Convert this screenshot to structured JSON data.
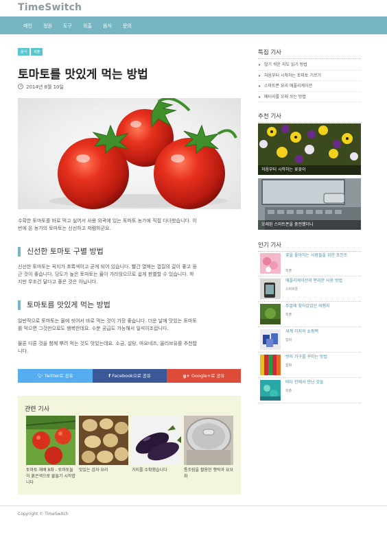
{
  "site": {
    "logo": "TimeSwitch"
  },
  "nav": [
    "메인",
    "정원",
    "도구",
    "외출",
    "음식",
    "문의"
  ],
  "article": {
    "tags": [
      "음식",
      "외출"
    ],
    "title": "토마토를 맛있게 먹는 방법",
    "date": "2014년 8월 10일",
    "intro_lines": [
      "수확한 토마토를 바로 먹고 싶어서 사용 외곽에 있는 토마토 농가에 직접 다녀왔습니다. 이",
      "번에 온 농가의 토마토는 신선하고 저렴하군요."
    ],
    "section1": {
      "heading": "신선한 토마토 구별 방법",
      "lines": [
        "신선한 토마토는 꼭지가 초록색이고 곧게 되어 있습니다. 빨간 열매는 껍질의 갈이 좋고 둥",
        "근 것이 좋습니다. 당도가 높은 토마토는 물이 가라앉으므로 쉽게 판별할 수 있습니다. 하",
        "지만 무조건 달다고 좋은 것은 아닙니다."
      ]
    },
    "section2": {
      "heading": "토마토를 맛있게 먹는 방법",
      "lines1": [
        "일반적으로 토마토는 물에 씻어서 바로 먹는 것이 가장 좋습니다. 더운 날에 맛있는 토마토",
        "를 먹으면 그것만으로도 행복한데요. 수분 공급도 가능해서 일석이조랍니다."
      ],
      "lines2": [
        "물론 다른 것을 함께 뿌려 먹는 것도 맛있는데요. 소금, 설탕, 마요네즈, 올리브유를 추천합",
        "니다."
      ]
    },
    "share": {
      "twitter": "Twitter로 공유",
      "facebook": "Facebook으로 공유",
      "google": "Google+로 공유"
    }
  },
  "related": {
    "title": "관련 기사",
    "items": [
      {
        "caption": "토마토 재배 8화 - 토마토들이 붉은색으로 물들기 시작합니다"
      },
      {
        "caption": "맛있는 감자 요리"
      },
      {
        "caption": "가지를 수확했습니다"
      },
      {
        "caption": "통조림을 활용한 행락과 요요화"
      }
    ]
  },
  "sidebar": {
    "featured": {
      "title": "특집 기사",
      "items": [
        "많기 쉬운 지도 읽기 방법",
        "처음부터 시작하는 토마토 기르기",
        "스마트폰 요리 애플리케이션",
        "배터리를 오래 쓰는 방법"
      ]
    },
    "recommended": {
      "title": "추천 기사",
      "items": [
        {
          "caption": "처음부터 시작하는 꽃꽂이"
        },
        {
          "caption": "오래된 스마트폰을 충전했더니"
        }
      ]
    },
    "popular": {
      "title": "인기 기사",
      "items": [
        {
          "title": "꽃을 좋아하는 사람들을 위한 포인트",
          "category": "외출"
        },
        {
          "title": "애플리케이션의 편리한 사용 방법",
          "category": "스마트폰"
        },
        {
          "title": "주말에 찾아갔었던 여행지",
          "category": "외출"
        },
        {
          "title": "세계 각지의 쇼핑백",
          "category": "잡화"
        },
        {
          "title": "방의 가구를 꾸미는 방법",
          "category": "잡화"
        },
        {
          "title": "바다 안에서 만난 것들",
          "category": "외출"
        }
      ]
    }
  },
  "footer": {
    "copyright": "Copyright © TimeSwitch"
  },
  "colors": {
    "nav": "#75b6c2",
    "tag": "#59c6cf",
    "twitter": "#55acee",
    "facebook": "#3b5998",
    "google": "#dd4b39",
    "related_bg": "#f4f5dd"
  }
}
